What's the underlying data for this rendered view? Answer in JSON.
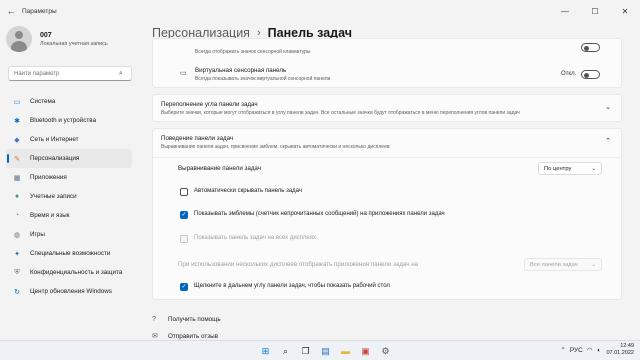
{
  "window": {
    "title": "Параметры",
    "back_glyph": "←",
    "minimize_glyph": "—",
    "maximize_glyph": "☐",
    "close_glyph": "✕"
  },
  "profile": {
    "name": "007",
    "account_type": "Локальная учетная запись"
  },
  "search": {
    "placeholder": "Найти параметр",
    "icon_glyph": "⌕"
  },
  "nav": {
    "items": [
      {
        "label": "Система",
        "glyph": "▭",
        "color": "#0078d4"
      },
      {
        "label": "Bluetooth и устройства",
        "glyph": "✱",
        "color": "#0067c0"
      },
      {
        "label": "Сеть и Интернет",
        "glyph": "◆",
        "color": "#3d7dc8"
      },
      {
        "label": "Персонализация",
        "glyph": "✎",
        "color": "#d07a2d"
      },
      {
        "label": "Приложения",
        "glyph": "▦",
        "color": "#5a6e8a"
      },
      {
        "label": "Учетные записи",
        "glyph": "●",
        "color": "#2e9e6b"
      },
      {
        "label": "Время и язык",
        "glyph": "◔",
        "color": "#3a88c9"
      },
      {
        "label": "Игры",
        "glyph": "◍",
        "color": "#6d6d6d"
      },
      {
        "label": "Специальные возможности",
        "glyph": "✦",
        "color": "#1e6fb5"
      },
      {
        "label": "Конфиденциальность и защита",
        "glyph": "⛨",
        "color": "#6d6d6d"
      },
      {
        "label": "Центр обновления Windows",
        "glyph": "↻",
        "color": "#0067c0"
      }
    ],
    "active_index": 3
  },
  "breadcrumb": {
    "parent": "Персонализация",
    "separator": "›",
    "current": "Панель задач"
  },
  "top_card": {
    "partial_desc": "Всегда отображать значок сенсорной клавиатуры",
    "touch_title": "Виртуальная сенсорная панель",
    "touch_desc": "Всегда показывать значок виртуальной сенсорной панели",
    "touch_state": "Откл.",
    "touch_icon_glyph": "▭"
  },
  "overflow": {
    "title": "Переполнение угла панели задач",
    "desc": "Выберите значки, которые могут отображаться в углу панели задач. Все остальные значки будут отображаться в меню переполнения углов панели задач",
    "chevron": "⌄"
  },
  "behavior": {
    "title": "Поведение панели задач",
    "desc": "Выравнивание панели задач, присвоение эмблем, скрывать автоматически и несколько дисплеев",
    "chevron": "⌃",
    "alignment_label": "Выравнивание панели задач",
    "alignment_value": "По центру",
    "autohide_label": "Автоматически скрывать панель задач",
    "badges_label": "Показывать эмблемы (счетчик непрочитанных сообщений) на приложениях панели задач",
    "all_displays_label": "Показывать панель задач на всех дисплеях",
    "multi_display_label": "При использовании нескольких дисплеев отображать приложения панели задач на",
    "multi_display_value": "Все панели задач",
    "corner_label": "Щелкните в дальнем углу панели задач, чтобы показать рабочий стол",
    "check_glyph": "✓",
    "dropdown_chevron": "⌄"
  },
  "links": {
    "help": "Получить помощь",
    "feedback": "Отправить отзыв",
    "help_glyph": "?",
    "feedback_glyph": "✉"
  },
  "taskbar": {
    "apps": [
      {
        "name": "start",
        "glyph": "⊞",
        "color": "#0078d4"
      },
      {
        "name": "search",
        "glyph": "⌕",
        "color": "#222222"
      },
      {
        "name": "task-view",
        "glyph": "❐",
        "color": "#222222"
      },
      {
        "name": "widgets",
        "glyph": "▤",
        "color": "#1f6fc4"
      },
      {
        "name": "explorer",
        "glyph": "▬",
        "color": "#e8b73a"
      },
      {
        "name": "store",
        "glyph": "▣",
        "color": "#c9473a"
      },
      {
        "name": "settings",
        "glyph": "⚙",
        "color": "#555555"
      }
    ],
    "tray_chevron": "⌃",
    "language": "РУС",
    "wifi_glyph": "◠",
    "volume_glyph": "◖",
    "time": "12:49",
    "date": "07.01.2022"
  }
}
